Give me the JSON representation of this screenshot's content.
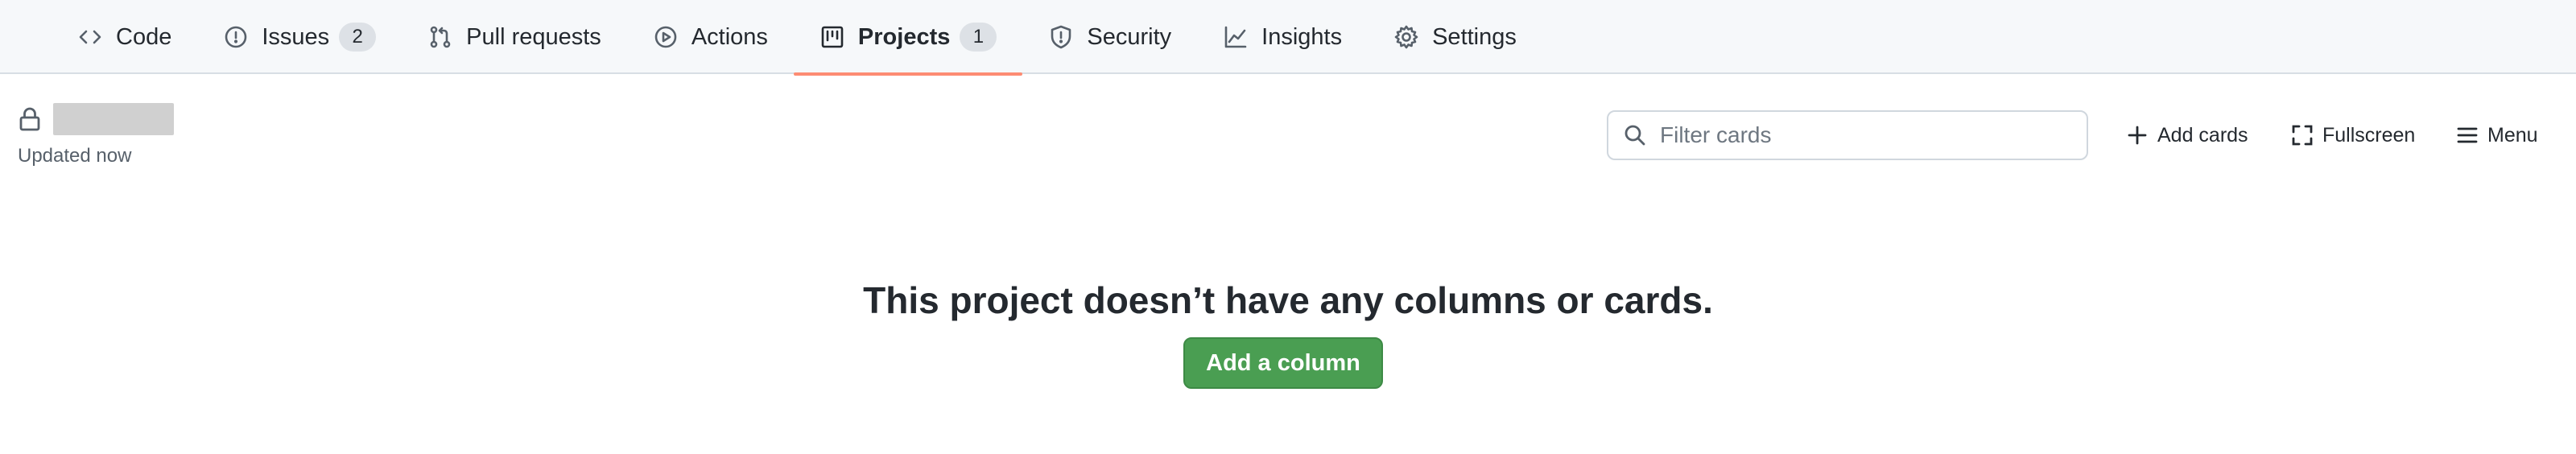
{
  "nav": {
    "tabs": [
      {
        "label": "Code",
        "icon": "code-icon"
      },
      {
        "label": "Issues",
        "icon": "issue-opened-icon",
        "count": "2"
      },
      {
        "label": "Pull requests",
        "icon": "git-pull-request-icon"
      },
      {
        "label": "Actions",
        "icon": "play-icon"
      },
      {
        "label": "Projects",
        "icon": "project-board-icon",
        "count": "1",
        "active": true
      },
      {
        "label": "Security",
        "icon": "shield-icon"
      },
      {
        "label": "Insights",
        "icon": "graph-icon"
      },
      {
        "label": "Settings",
        "icon": "gear-icon"
      }
    ],
    "active_underline_color": "#fd8c73"
  },
  "project": {
    "updated_text": "Updated now"
  },
  "toolbar": {
    "filter_placeholder": "Filter cards",
    "add_cards_label": "Add cards",
    "fullscreen_label": "Fullscreen",
    "menu_label": "Menu"
  },
  "empty_state": {
    "message": "This project doesn’t have any columns or cards.",
    "button_label": "Add a column",
    "button_color": "#4a9e52"
  }
}
